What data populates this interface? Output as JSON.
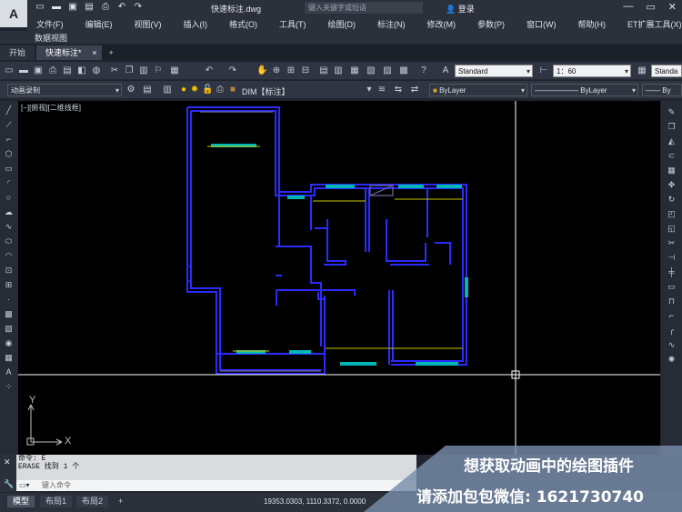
{
  "app": {
    "doc_title": "快速标注.dwg",
    "search_placeholder": "键入关键字或短语",
    "login_label": "登录"
  },
  "menu": [
    "文件(F)",
    "编辑(E)",
    "视图(V)",
    "插入(I)",
    "格式(O)",
    "工具(T)",
    "绘图(D)",
    "标注(N)",
    "修改(M)",
    "参数(P)",
    "窗口(W)",
    "帮助(H)",
    "ET扩展工具(X)"
  ],
  "menu2": "数据视图",
  "tabs": [
    {
      "label": "开始"
    },
    {
      "label": "快速标注*",
      "close": "×"
    },
    {
      "label": "+"
    }
  ],
  "toolbar": {
    "text_style": "Standard",
    "dim_scale": "1：60",
    "table_style": "Standa",
    "workspace": "动画录制",
    "layer": "DIM【标注】",
    "color": "ByLayer",
    "linetype": "ByLayer",
    "lineweight": "By"
  },
  "viewport_label": "[−][俯视][二维线框]",
  "command": {
    "line1": "命令: E",
    "line2": "ERASE 找到 1 个",
    "placeholder": "键入命令"
  },
  "layout_tabs": [
    "模型",
    "布局1",
    "布局2",
    "+"
  ],
  "coords": "19353.0303, 1110.3372, 0.0000",
  "promo": {
    "line1": "想获取动画中的绘图插件",
    "line2": "请添加包包微信: 1621730740"
  },
  "colors": {
    "wall": "#2b2bff",
    "window": "#00b5b5",
    "dim_line": "#c8c800",
    "crosshair": "#ffffff",
    "canvas": "#000000"
  }
}
